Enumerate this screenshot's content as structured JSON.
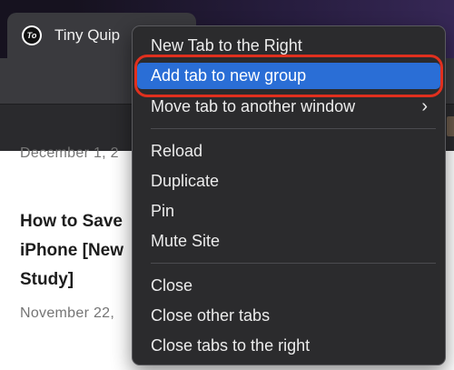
{
  "tab": {
    "title": "Tiny Quip",
    "favicon_text": "To"
  },
  "content": {
    "date1": "December 1, 2",
    "article_title_lines": [
      "How to Save",
      "iPhone [New",
      "Study]"
    ],
    "date2": "November 22,"
  },
  "menu": {
    "items": [
      {
        "label": "New Tab to the Right"
      },
      {
        "label": "Add tab to new group",
        "highlighted": true
      },
      {
        "label": "Move tab to another window",
        "submenu": true
      },
      {
        "label": "Reload"
      },
      {
        "label": "Duplicate"
      },
      {
        "label": "Pin"
      },
      {
        "label": "Mute Site"
      },
      {
        "label": "Close"
      },
      {
        "label": "Close other tabs"
      },
      {
        "label": "Close tabs to the right"
      }
    ],
    "submenu_glyph": "›"
  },
  "colors": {
    "highlight": "#2a6ed6",
    "annotation_ring": "#e0301e",
    "menu_bg": "#2b2b2d"
  }
}
